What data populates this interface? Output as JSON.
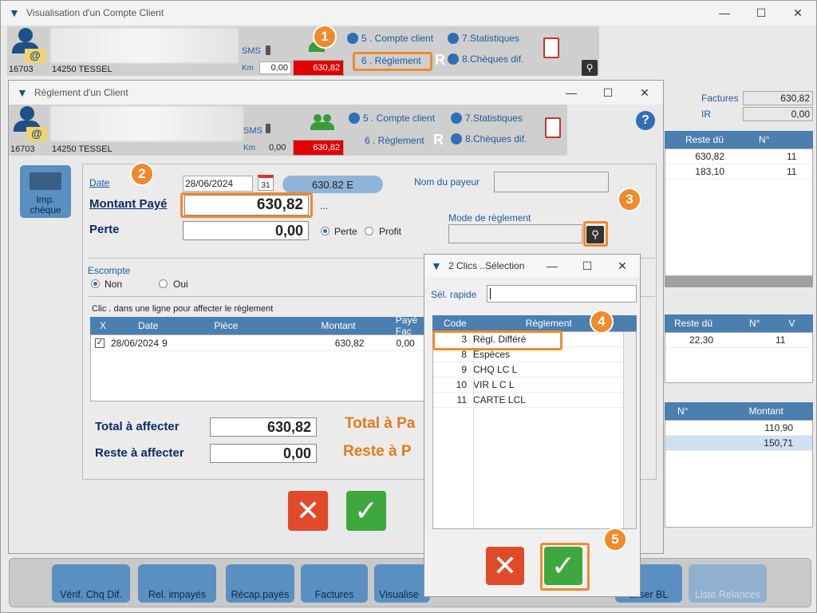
{
  "main_window": {
    "title": "Visualisation d'un Compte Client",
    "client_code": "16703",
    "client_city": "14250 TESSEL",
    "sms_label": "SMS",
    "km_label": "Km",
    "km_value": "0,00",
    "balance": "630,82",
    "links": {
      "compte_client": "5 . Compte client",
      "statistiques": "7.Statistiques",
      "reglement": "6 . Règlement",
      "cheques_dif": "8.Chèques dif."
    },
    "right_panel": {
      "factures_label": "Factures",
      "factures_value": "630,82",
      "ir_label": "IR",
      "ir_value": "0,00",
      "grid1_headers": [
        "Reste dû",
        "N°"
      ],
      "grid1_rows": [
        [
          "630,82",
          "11"
        ],
        [
          "183,10",
          "11"
        ]
      ],
      "grid2_headers": [
        "Reste dû",
        "N°",
        "V"
      ],
      "grid2_rows": [
        [
          "22,30",
          "11"
        ]
      ],
      "grid3_headers": [
        "N°",
        "Montant"
      ],
      "grid3_rows": [
        [
          "",
          "110,90"
        ],
        [
          "",
          "150,71"
        ]
      ]
    },
    "toolbar": {
      "verif_chq": "Vérif. Chq Dif.",
      "rel_impayes": "Rel. impayés",
      "recap_payes": "Récap.payés",
      "factures": "Factures",
      "visualiser": "Visualise",
      "visualiser_bl": "aliser BL",
      "liste_relances": "Liste Relances"
    }
  },
  "reglement_window": {
    "title": "Règlement d'un  Client",
    "client_code": "16703",
    "client_city": "14250 TESSEL",
    "sms_label": "SMS",
    "km_label": "Km",
    "km_value": "0,00",
    "balance": "630,82",
    "links": {
      "compte_client": "5 . Compte client",
      "statistiques": "7.Statistiques",
      "reglement": "6 . Règlement",
      "cheques_dif": "8.Chèques dif."
    },
    "imp_cheque": "Imp.\nchèque",
    "date_label": "Date",
    "date_value": "28/06/2024",
    "amount_badge": "630.82 E",
    "payer_label": "Nom du payeur",
    "montant_label": "Montant Payé",
    "montant_value": "630,82",
    "ellipsis": "...",
    "perte_label": "Perte",
    "perte_value": "0,00",
    "radio_perte": "Perte",
    "radio_profit": "Profit",
    "mode_label": "Mode de règlement",
    "escompte_label": "Escompte",
    "escompte_non": "Non",
    "escompte_oui": "Oui",
    "instruction": "Clic . dans une ligne pour affecter le règlement",
    "grid_headers": [
      "X",
      "Date",
      "Pièce",
      "Montant",
      "Payé Fac"
    ],
    "grid_rows": [
      {
        "checked": true,
        "date": "28/06/2024",
        "piece": "9",
        "montant": "630,82",
        "paye": "0,00"
      }
    ],
    "total_affecter_label": "Total à affecter",
    "total_affecter_value": "630,82",
    "reste_affecter_label": "Reste à affecter",
    "reste_affecter_value": "0,00",
    "total_pa_label": "Total à Pa",
    "reste_pa_label": "Reste à P"
  },
  "selection_window": {
    "title": "2 Clics  ..Sélection",
    "quick_label": "Sél. rapide",
    "quick_value": "",
    "headers": [
      "Code",
      "Règlement"
    ],
    "rows": [
      {
        "code": "3",
        "label": "Règl. Différé"
      },
      {
        "code": "8",
        "label": "Espèces"
      },
      {
        "code": "9",
        "label": "CHQ  LC L"
      },
      {
        "code": "10",
        "label": "VIR L C L"
      },
      {
        "code": "11",
        "label": "CARTE LCL"
      }
    ]
  },
  "callouts": [
    "1",
    "2",
    "3",
    "4",
    "5"
  ],
  "colors": {
    "accent": "#f08a2c",
    "grid_header": "#4a7fb0",
    "balance_red": "#e00000",
    "ok": "#3ea83e",
    "cancel": "#e04a2a"
  }
}
